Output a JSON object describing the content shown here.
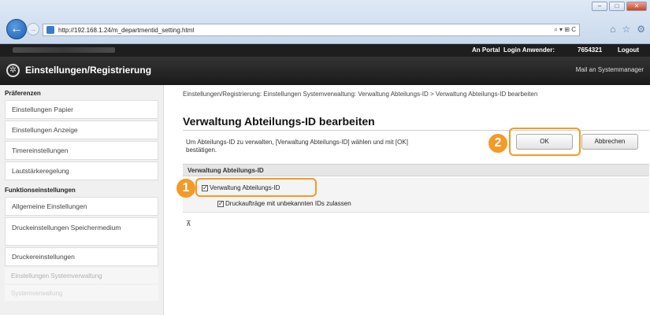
{
  "browser": {
    "url": "http://192.168.1.24/m_departmentid_setting.html",
    "search_icons": "⌕ ▾ ⊞ C",
    "window_controls": [
      "–",
      "□",
      "✕"
    ],
    "toolbar_icons": [
      "⌂",
      "☆",
      "⚙"
    ]
  },
  "topbar": {
    "portal": "An Portal",
    "login_label": "Login Anwender:",
    "login_user": "7654321",
    "logout": "Logout"
  },
  "titlebar": {
    "title": "Einstellungen/Registrierung",
    "mail": "Mail an Systemmanager",
    "icon": "gear-icon"
  },
  "sidebar": {
    "head1": "Präferenzen",
    "items1": [
      "Einstellungen Papier",
      "Einstellungen Anzeige",
      "Timereinstellungen",
      "Lautstärkeregelung"
    ],
    "head2": "Funktionseinstellungen",
    "items2": [
      "Allgemeine Einstellungen",
      "Druckeinstellungen Speichermedium",
      "Druckereinstellungen"
    ],
    "faded1": "Einstellungen Systemverwaltung",
    "faded2": "Systemverwaltung"
  },
  "main": {
    "breadcrumb": "Einstellungen/Registrierung: Einstellungen Systemverwaltung: Verwaltung Abteilungs-ID > Verwaltung Abteilungs-ID bearbeiten",
    "title": "Verwaltung Abteilungs-ID bearbeiten",
    "desc_line1": "Um Abteilungs-ID zu verwalten, [Verwaltung Abteilungs-ID] wählen und mit [OK]",
    "desc_line2": "bestätigen.",
    "ok_label": "OK",
    "cancel_label": "Abbrechen",
    "section_header": "Verwaltung Abteilungs-ID",
    "option_main": "Verwaltung Abteilungs-ID",
    "option_main_checked": true,
    "option_sub": "Druckaufträge mit unbekannten IDs zulassen",
    "option_sub_checked": true,
    "expand_glyph": "⊼"
  },
  "annotations": {
    "badge1": "1",
    "badge2": "2",
    "color": "#f39a28"
  }
}
